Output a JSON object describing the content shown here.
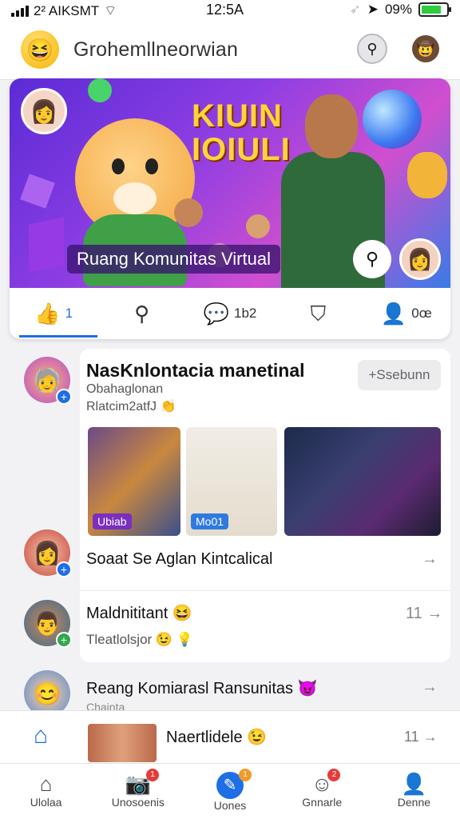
{
  "status_bar": {
    "carrier": "2² AIKSMT",
    "time": "12:5A",
    "battery": "09%"
  },
  "app": {
    "title": "Grohemllneorwian"
  },
  "hero": {
    "banner_title_line1": "KIUIN",
    "banner_title_line2": "IOIULI",
    "caption": "Ruang Komunitas Virtual",
    "actions": [
      {
        "icon": "thumbs-up-icon",
        "glyph": "👍",
        "label": "1"
      },
      {
        "icon": "search-icon",
        "glyph": "⚲",
        "label": ""
      },
      {
        "icon": "comment-icon",
        "glyph": "💬",
        "label": "1b2"
      },
      {
        "icon": "shield-icon",
        "glyph": "⛉",
        "label": ""
      },
      {
        "icon": "user-icon",
        "glyph": "👤",
        "label": "0œ"
      }
    ]
  },
  "post": {
    "title": "NasKnlontacia manetinal",
    "subtitle1": "Obahaglonan",
    "subtitle2": "Rlatcim2atfJ",
    "join_label": "+Ssebunn",
    "thumbnail_tags": [
      "Ubiab",
      "Mo01"
    ]
  },
  "rows": [
    {
      "title": "Soaat Se Aglan Kintcalical",
      "subtitle": "",
      "count": ""
    },
    {
      "title": "Maldnititant 😆",
      "subtitle": "Tleatlolsjor 😉 💡",
      "count": "11"
    },
    {
      "title": "Reang Komiarasl Ransunitas 😈",
      "subtitle": "Chainta",
      "count": ""
    }
  ],
  "mini_player": {
    "title": "Naertlidele 😉",
    "count": "11"
  },
  "tabs": [
    {
      "label": "Ulolaa",
      "icon": "home-icon",
      "glyph": "⌂",
      "badge": ""
    },
    {
      "label": "Unosoenis",
      "icon": "camera-icon",
      "glyph": "📷",
      "badge": "1"
    },
    {
      "label": "Uones",
      "icon": "create-icon",
      "glyph": "✎",
      "badge": "1"
    },
    {
      "label": "Gnnarle",
      "icon": "notification-icon",
      "glyph": "☺",
      "badge": "2"
    },
    {
      "label": "Denne",
      "icon": "profile-icon",
      "glyph": "👤",
      "badge": ""
    }
  ],
  "colors": {
    "accent": "#1e6fe6",
    "badge_red": "#e63b3b",
    "battery_green": "#2ecc40"
  }
}
